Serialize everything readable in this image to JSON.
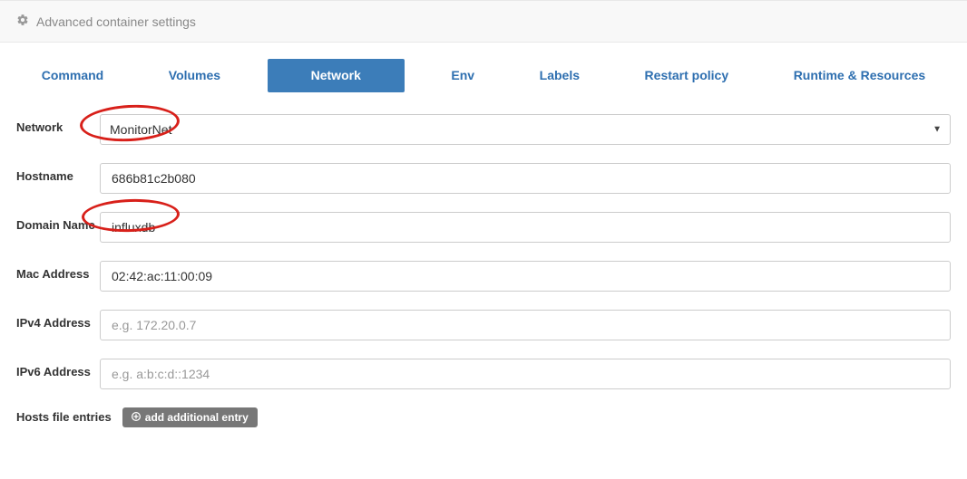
{
  "header": {
    "title": "Advanced container settings"
  },
  "tabs": {
    "items": [
      {
        "label": "Command"
      },
      {
        "label": "Volumes"
      },
      {
        "label": "Network"
      },
      {
        "label": "Env"
      },
      {
        "label": "Labels"
      },
      {
        "label": "Restart policy"
      },
      {
        "label": "Runtime & Resources"
      }
    ],
    "active_index": 2
  },
  "form": {
    "network": {
      "label": "Network",
      "value": "MonitorNet"
    },
    "hostname": {
      "label": "Hostname",
      "value": "686b81c2b080"
    },
    "domain_name": {
      "label": "Domain Name",
      "value": "influxdb"
    },
    "mac_address": {
      "label": "Mac Address",
      "value": "02:42:ac:11:00:09"
    },
    "ipv4": {
      "label": "IPv4 Address",
      "value": "",
      "placeholder": "e.g. 172.20.0.7"
    },
    "ipv6": {
      "label": "IPv6 Address",
      "value": "",
      "placeholder": "e.g. a:b:c:d::1234"
    },
    "hosts": {
      "label": "Hosts file entries",
      "add_button": "add additional entry"
    }
  }
}
